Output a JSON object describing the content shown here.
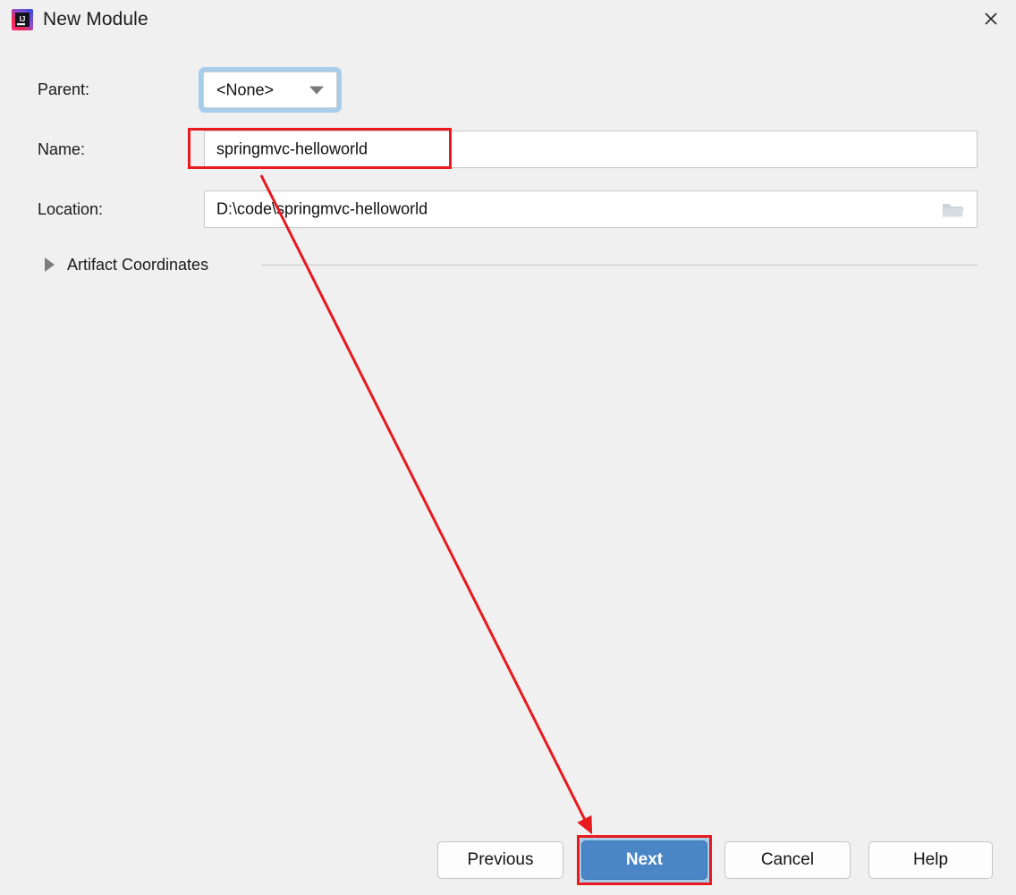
{
  "window": {
    "title": "New Module",
    "app_icon": "intellij-idea-logo",
    "close_label": "✕",
    "background_color": "#f0f0f0"
  },
  "form": {
    "parent": {
      "label": "Parent:",
      "value": "<None>",
      "icon": "chevron-down-icon",
      "focused": true,
      "focus_ring_color": "#a8cdeb"
    },
    "name": {
      "label": "Name:",
      "value": "springmvc-helloworld",
      "placeholder": ""
    },
    "location": {
      "label": "Location:",
      "value": "D:\\code\\springmvc-helloworld",
      "placeholder": "",
      "browse_icon": "folder-icon"
    },
    "artifact_coordinates": {
      "label": "Artifact Coordinates",
      "expanded": false,
      "icon": "triangle-right-icon"
    }
  },
  "buttons": {
    "previous": "Previous",
    "next": "Next",
    "cancel": "Cancel",
    "help": "Help",
    "primary_color": "#4a86c5"
  },
  "annotations": {
    "highlight_color": "#e8191f",
    "name_field_highlight": "Name field highlighted",
    "next_button_highlight": "Next button highlighted",
    "arrow": "arrow from name field to next button"
  }
}
